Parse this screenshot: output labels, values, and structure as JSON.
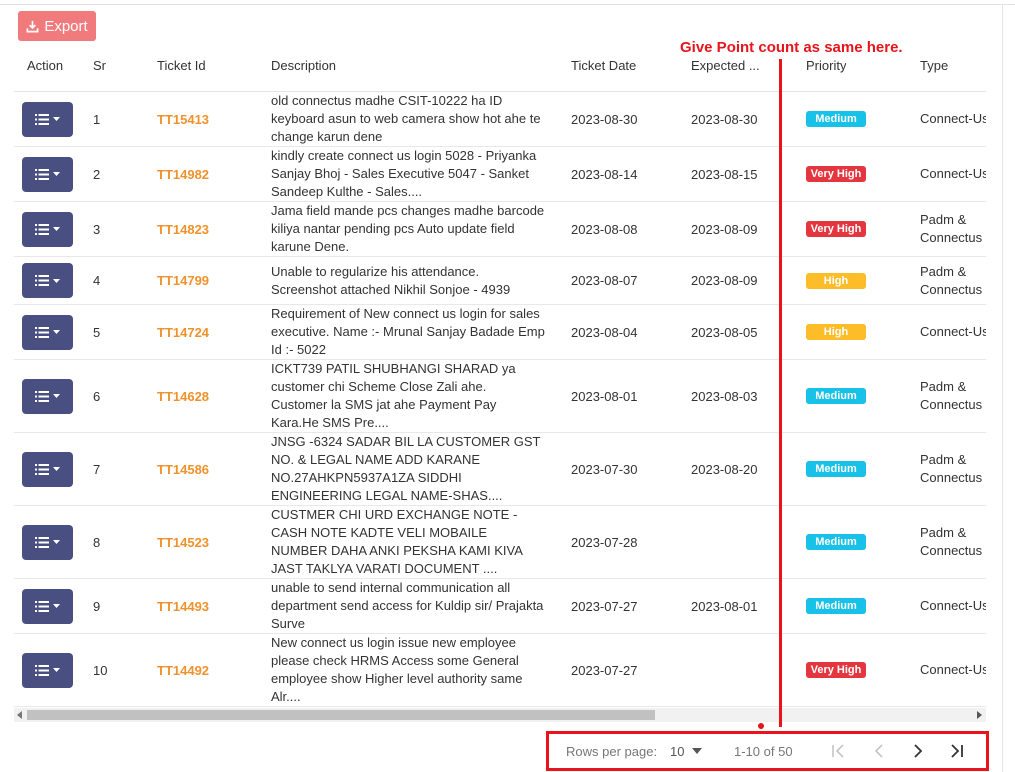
{
  "toolbar": {
    "export_label": "Export"
  },
  "annotation": {
    "text": "Give Point count as same here."
  },
  "table": {
    "headers": {
      "action": "Action",
      "sr": "Sr",
      "ticket_id": "Ticket Id",
      "description": "Description",
      "ticket_date": "Ticket Date",
      "expected": "Expected ...",
      "priority": "Priority",
      "type": "Type"
    },
    "rows": [
      {
        "sr": "1",
        "ticket_id": "TT15413",
        "description": "old connectus madhe CSIT-10222 ha ID keyboard asun to web camera show hot ahe te change karun dene",
        "ticket_date": "2023-08-30",
        "expected": "2023-08-30",
        "priority": "Medium",
        "type_line1": "Connect-Us",
        "type_line2": ""
      },
      {
        "sr": "2",
        "ticket_id": "TT14982",
        "description": "kindly create connect us login 5028 - Priyanka Sanjay Bhoj - Sales Executive 5047 - Sanket Sandeep Kulthe - Sales....",
        "ticket_date": "2023-08-14",
        "expected": "2023-08-15",
        "priority": "Very High",
        "type_line1": "Connect-Us",
        "type_line2": ""
      },
      {
        "sr": "3",
        "ticket_id": "TT14823",
        "description": "Jama field mande pcs changes madhe barcode kiliya nantar pending pcs Auto update field karune Dene.",
        "ticket_date": "2023-08-08",
        "expected": "2023-08-09",
        "priority": "Very High",
        "type_line1": "Padm &",
        "type_line2": "Connectus"
      },
      {
        "sr": "4",
        "ticket_id": "TT14799",
        "description": "Unable to regularize his attendance. Screenshot attached Nikhil Sonjoe - 4939",
        "ticket_date": "2023-08-07",
        "expected": "2023-08-09",
        "priority": "High",
        "type_line1": "Padm &",
        "type_line2": "Connectus"
      },
      {
        "sr": "5",
        "ticket_id": "TT14724",
        "description": "Requirement of New connect us login for sales executive. Name :- Mrunal Sanjay Badade Emp Id :- 5022",
        "ticket_date": "2023-08-04",
        "expected": "2023-08-05",
        "priority": "High",
        "type_line1": "Connect-Us",
        "type_line2": ""
      },
      {
        "sr": "6",
        "ticket_id": "TT14628",
        "description": "ICKT739 PATIL SHUBHANGI SHARAD ya customer chi Scheme Close Zali ahe. Customer la SMS jat ahe Payment Pay Kara.He SMS Pre....",
        "ticket_date": "2023-08-01",
        "expected": "2023-08-03",
        "priority": "Medium",
        "type_line1": "Padm &",
        "type_line2": "Connectus"
      },
      {
        "sr": "7",
        "ticket_id": "TT14586",
        "description": "JNSG -6324 SADAR BIL LA CUSTOMER GST NO. & LEGAL NAME ADD KARANE NO.27AHKPN5937A1ZA SIDDHI ENGINEERING LEGAL NAME-SHAS....",
        "ticket_date": "2023-07-30",
        "expected": "2023-08-20",
        "priority": "Medium",
        "type_line1": "Padm &",
        "type_line2": "Connectus"
      },
      {
        "sr": "8",
        "ticket_id": "TT14523",
        "description": "CUSTMER CHI URD EXCHANGE NOTE - CASH NOTE KADTE VELI MOBAILE NUMBER DAHA ANKI PEKSHA KAMI KIVA JAST TAKLYA VARATI DOCUMENT ....",
        "ticket_date": "2023-07-28",
        "expected": "",
        "priority": "Medium",
        "type_line1": "Padm &",
        "type_line2": "Connectus"
      },
      {
        "sr": "9",
        "ticket_id": "TT14493",
        "description": "unable to send internal communication all department send access for Kuldip sir/ Prajakta Surve",
        "ticket_date": "2023-07-27",
        "expected": "2023-08-01",
        "priority": "Medium",
        "type_line1": "Connect-Us",
        "type_line2": ""
      },
      {
        "sr": "10",
        "ticket_id": "TT14492",
        "description": "New connect us login issue new employee please check HRMS Access some General employee show Higher level authority same Alr....",
        "ticket_date": "2023-07-27",
        "expected": "",
        "priority": "Very High",
        "type_line1": "Connect-Us",
        "type_line2": ""
      }
    ]
  },
  "priority_colors": {
    "Medium": "#17c1e8",
    "Very High": "#e3363f",
    "High": "#fcbd29"
  },
  "pagination": {
    "rows_per_page_label": "Rows per page:",
    "rows_per_page_value": "10",
    "range": "1-10 of 50"
  },
  "colors": {
    "accent_export": "#f07a7c",
    "action_button": "#4a4f82",
    "ticket_id": "#f0922b",
    "annotation": "#e8141b"
  }
}
